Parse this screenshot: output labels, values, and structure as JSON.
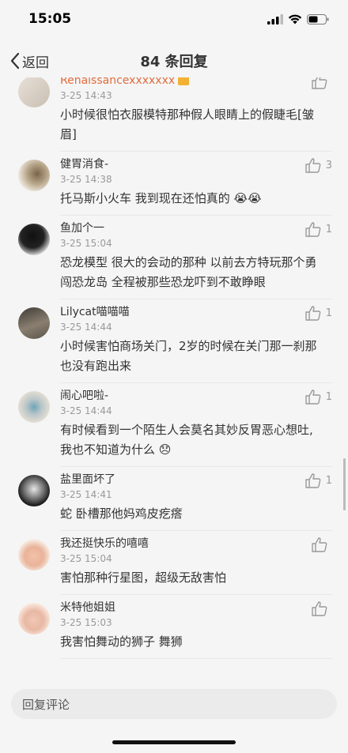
{
  "status": {
    "time": "15:05"
  },
  "nav": {
    "back_label": "返回",
    "title": "84 条回复"
  },
  "comments": [
    {
      "username": "Renaissancexxxxxxx",
      "time": "3-25 14:43",
      "text": "小时候很怕衣服模特那种假人眼睛上的假睫毛[皱眉]",
      "likes": ""
    },
    {
      "username": "健胃消食-",
      "time": "3-25 14:38",
      "text": "托马斯小火车 我到现在还怕真的 😭😭",
      "likes": "3"
    },
    {
      "username": "鱼加个一",
      "time": "3-25 15:04",
      "text": "恐龙模型 很大的会动的那种 以前去方特玩那个勇闯恐龙岛 全程被那些恐龙吓到不敢睁眼",
      "likes": "1"
    },
    {
      "username": "Lilycat喵喵喵",
      "time": "3-25 14:44",
      "text": "小时候害怕商场关门，2岁的时候在关门那一刹那也没有跑出来",
      "likes": "1"
    },
    {
      "username": "闹心吧啦-",
      "time": "3-25 14:44",
      "text": "有时候看到一个陌生人会莫名其妙反胃恶心想吐,我也不知道为什么 😞",
      "likes": "1"
    },
    {
      "username": "盐里面坏了",
      "time": "3-25 14:41",
      "text": "蛇 卧槽那他妈鸡皮疙瘩",
      "likes": "1"
    },
    {
      "username": "我还挺快乐的嘻嘻",
      "time": "3-25 15:04",
      "text": "害怕那种行星图，超级无敌害怕",
      "likes": ""
    },
    {
      "username": "米特他姐姐",
      "time": "3-25 15:03",
      "text": "我害怕舞动的狮子  舞狮",
      "likes": ""
    }
  ],
  "reply": {
    "placeholder": "回复评论"
  },
  "colors": {
    "accent_badge": "#f2b133",
    "username_first": "#e06c3c"
  }
}
